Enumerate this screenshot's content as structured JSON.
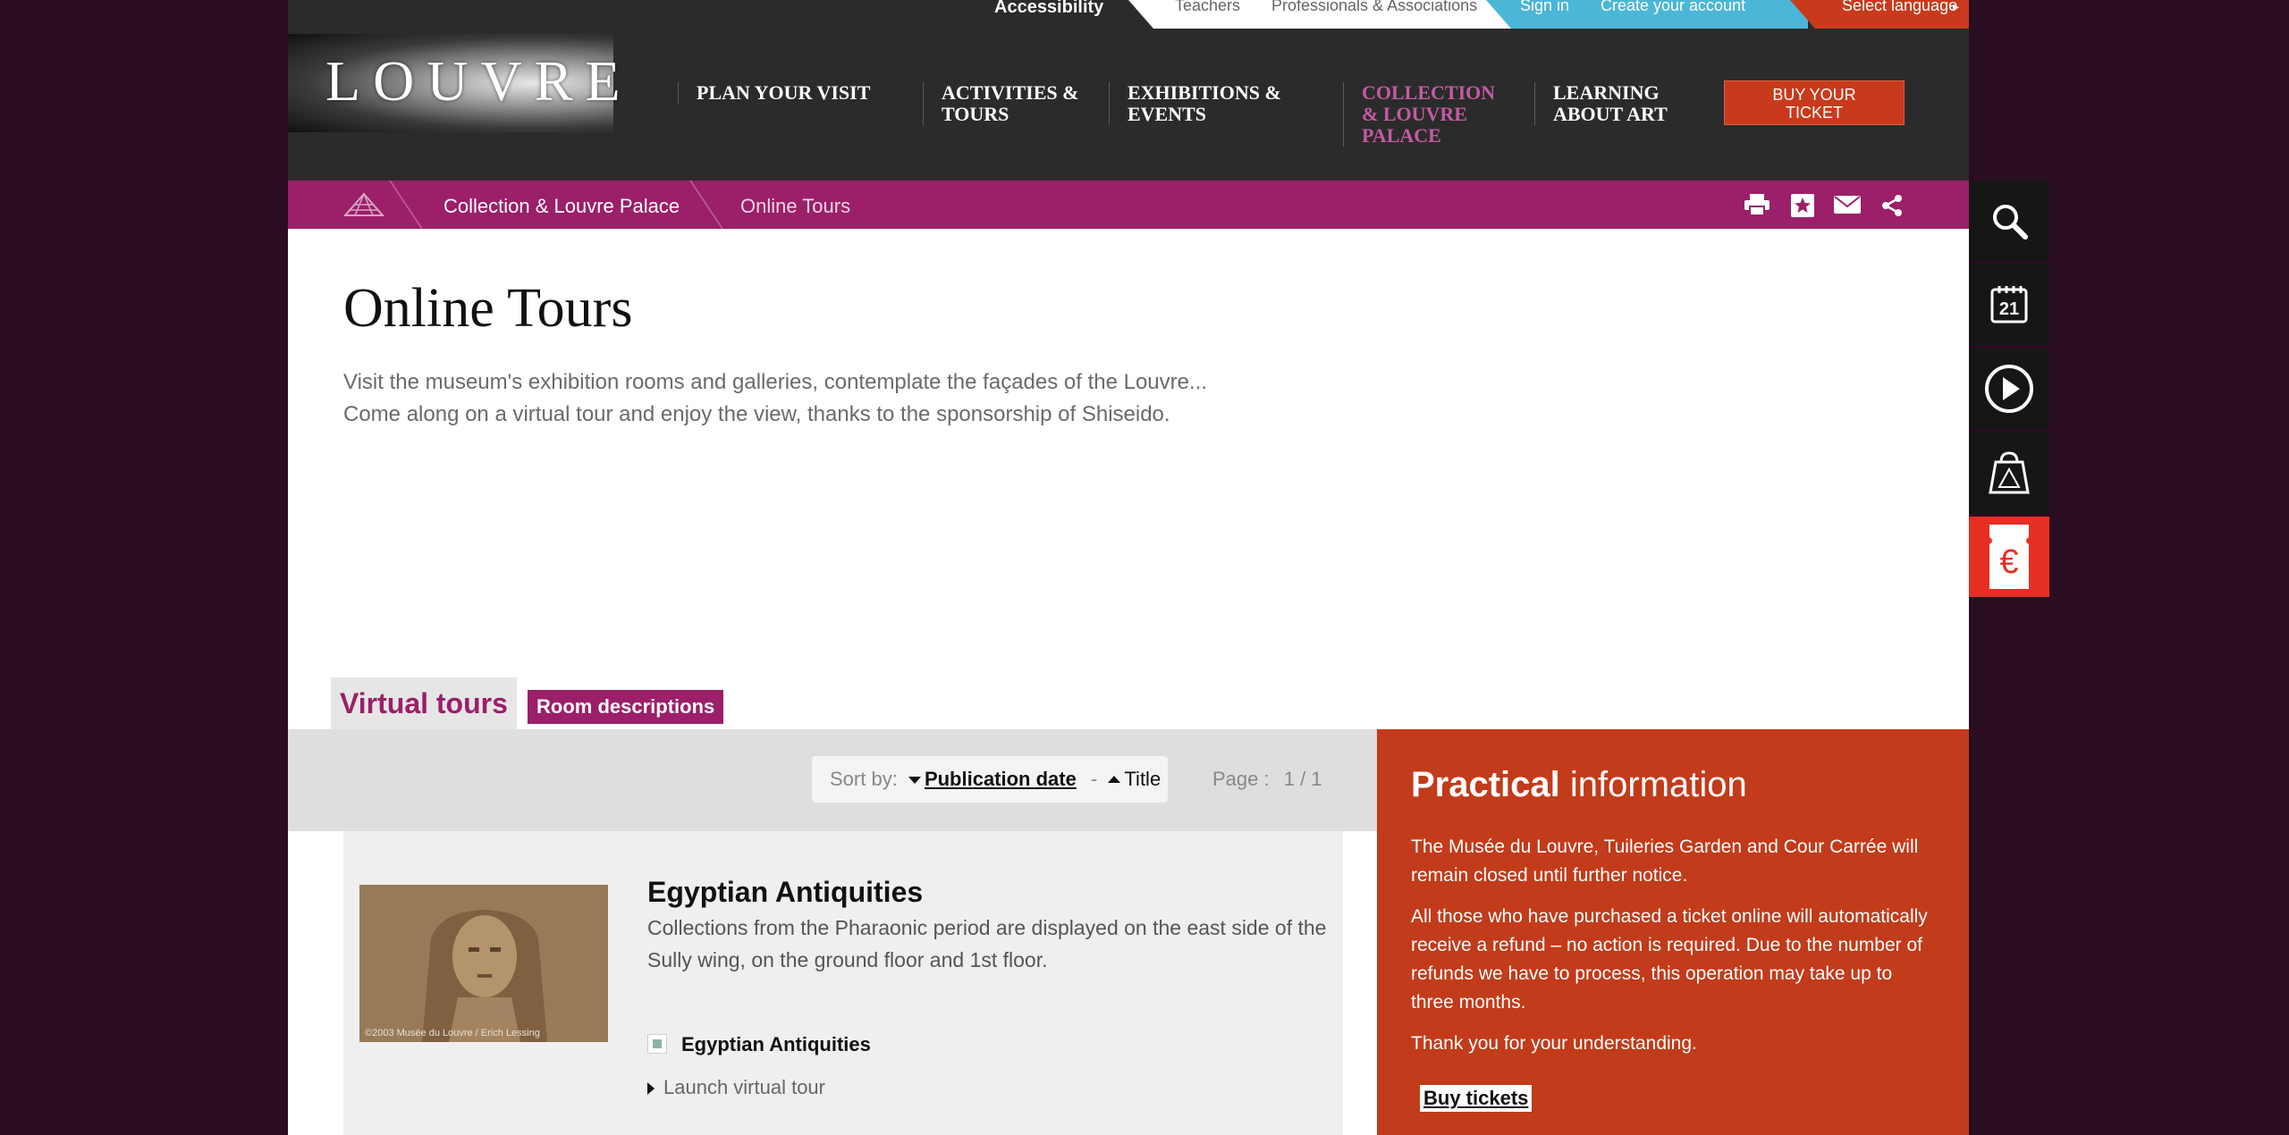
{
  "topbar": {
    "accessibility": "Accessibility",
    "teachers": "Teachers",
    "professionals": "Professionals & Associations",
    "sign_in": "Sign in",
    "create_account": "Create your account",
    "select_language": "Select language"
  },
  "header": {
    "logo_text": "LOUVRE",
    "nav": [
      {
        "label": "PLAN YOUR VISIT"
      },
      {
        "label": "ACTIVITIES & TOURS"
      },
      {
        "label": "EXHIBITIONS & EVENTS"
      },
      {
        "label": "COLLECTION & LOUVRE PALACE"
      },
      {
        "label": "LEARNING ABOUT ART"
      }
    ],
    "buy_ticket": "BUY YOUR TICKET"
  },
  "breadcrumb": {
    "items": [
      "Collection & Louvre Palace",
      "Online Tours"
    ]
  },
  "page": {
    "title": "Online Tours",
    "intro_line1": "Visit the museum's exhibition rooms and galleries, contemplate the façades of the Louvre...",
    "intro_line2": "Come along on a virtual tour and enjoy the view, thanks to the sponsorship of Shiseido."
  },
  "tabs": {
    "active": "Virtual tours",
    "inactive": "Room descriptions"
  },
  "sort": {
    "label": "Sort by:",
    "publication_date": "Publication date",
    "separator": "-",
    "title": "Title",
    "page_label": "Page :",
    "page_value": "1 / 1"
  },
  "results": [
    {
      "title": "Egyptian Antiquities",
      "description": "Collections from the Pharaonic period are displayed on the east side of the Sully wing, on the ground floor and 1st floor.",
      "tag": "Egyptian Antiquities",
      "link": "Launch virtual tour",
      "image_credit": "©2003 Musée du Louvre / Erich Lessing"
    }
  ],
  "practical": {
    "heading_bold": "Practical",
    "heading_rest": " information",
    "p1": "The Musée du Louvre, Tuileries Garden and Cour Carrée will remain closed until further notice.",
    "p2": "All those who have purchased a ticket online will automatically receive a refund – no action is required. Due to the number of refunds we have to process, this operation may take up to three months.",
    "p3": "Thank you for your understanding.",
    "button": "Buy tickets"
  },
  "sidebar_tools": {
    "calendar_day": "21",
    "euro_symbol": "€"
  },
  "colors": {
    "brand_purple": "#9b1f69",
    "accent_red": "#c23b1a",
    "header_dark": "#2b2b2b",
    "signin_blue": "#4cb6d6",
    "nav_active": "#c45aa3"
  }
}
